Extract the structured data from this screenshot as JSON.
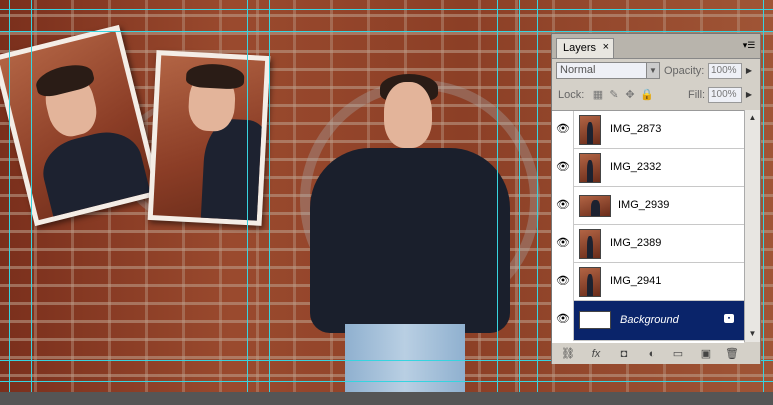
{
  "panel": {
    "tab_label": "Layers",
    "tab_close": "×",
    "menu_icon": "panel-menu-icon",
    "blend_mode": "Normal",
    "opacity_label": "Opacity:",
    "opacity_value": "100%",
    "lock_label": "Lock:",
    "fill_label": "Fill:",
    "fill_value": "100%",
    "layers": [
      {
        "name": "IMG_2873",
        "visible": true,
        "selected": false
      },
      {
        "name": "IMG_2332",
        "visible": true,
        "selected": false
      },
      {
        "name": "IMG_2939",
        "visible": true,
        "selected": false
      },
      {
        "name": "IMG_2389",
        "visible": true,
        "selected": false
      },
      {
        "name": "IMG_2941",
        "visible": true,
        "selected": false
      },
      {
        "name": "Background",
        "visible": true,
        "selected": true,
        "locked": true
      }
    ],
    "footer_icons": [
      "link-icon",
      "fx-icon",
      "mask-icon",
      "adjustment-icon",
      "group-folder-icon",
      "new-layer-icon",
      "trash-icon"
    ],
    "footer_glyphs": {
      "link": "⛓",
      "fx": "fx",
      "mask": "◘",
      "adjust": "◐",
      "folder": "▭",
      "new": "▣",
      "trash": "🗑"
    }
  },
  "colors": {
    "selection": "#0a246a",
    "guides": "#36d4e0",
    "panel_bg": "#d4d0c8"
  }
}
